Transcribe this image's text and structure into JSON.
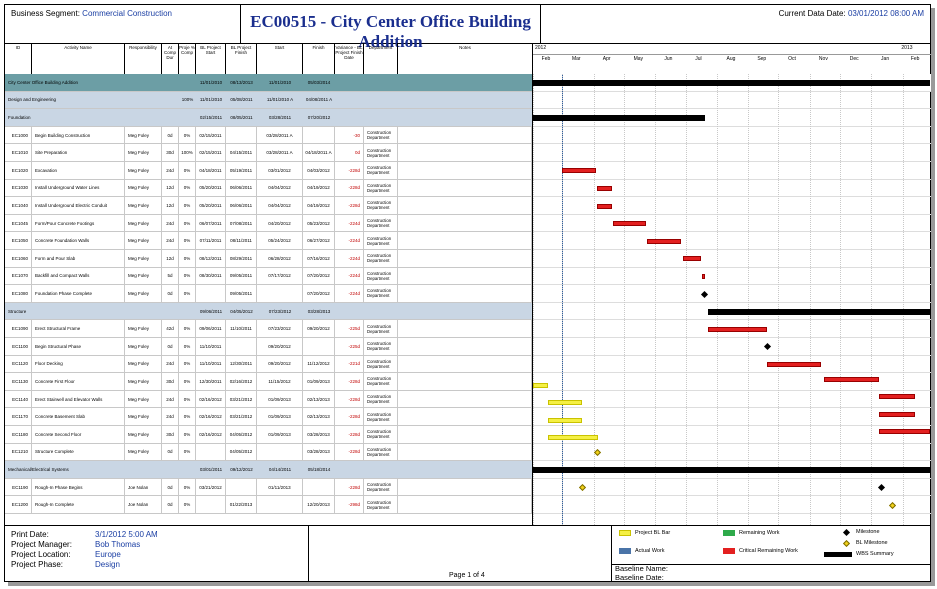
{
  "header": {
    "segment_label": "Business Segment:",
    "segment_value": "Commercial Construction",
    "title": "EC00515 - City Center Office Building Addition",
    "data_date_label": "Current Data Date:",
    "data_date_value": "03/01/2012 08:00 AM"
  },
  "columns": [
    "ID",
    "Activity Name",
    "Responsibility",
    "At Comp Dur",
    "Proje % Comp",
    "BL Project Start",
    "BL Project Finish",
    "Start",
    "Finish",
    "Variance - BL Project Finish Date",
    "Department",
    "Notes"
  ],
  "timeline": {
    "years": [
      {
        "label": "2012"
      },
      {
        "label": "2013"
      }
    ],
    "months": [
      "Feb",
      "Mar",
      "Apr",
      "May",
      "Jun",
      "Jul",
      "Aug",
      "Sep",
      "Oct",
      "Nov",
      "Dec",
      "Jan",
      "Feb"
    ]
  },
  "rows": [
    {
      "type": "sum1",
      "name": "City Center Office Building Addition",
      "bls": "11/01/2010",
      "blf": "08/13/2013",
      "start": "11/01/2010",
      "finish": "05/03/2014"
    },
    {
      "type": "sum2",
      "name": "Design and Engineering",
      "pct": "100%",
      "bls": "11/01/2010",
      "blf": "05/08/2011",
      "start": "11/01/2010 A",
      "finish": "04/08/2011 A"
    },
    {
      "type": "sum2",
      "name": "Foundation",
      "bls": "02/15/2011",
      "blf": "08/05/2011",
      "start": "03/28/2011",
      "finish": "07/20/2012"
    },
    {
      "type": "task",
      "id": "EC1000",
      "name": "Begin Building Construction",
      "resp": "Meg Foley",
      "dur": "0d",
      "pct": "0%",
      "bls": "02/15/2011",
      "blf": "",
      "start": "03/28/2011 A",
      "finish": "",
      "var": "-30",
      "dept": "Construction Department"
    },
    {
      "type": "task",
      "id": "EC1010",
      "name": "Site Preparation",
      "resp": "Meg Foley",
      "dur": "30d",
      "pct": "100%",
      "bls": "02/15/2011",
      "blf": "04/15/2011",
      "start": "03/28/2011 A",
      "finish": "04/18/2011 A",
      "var": "0d",
      "dept": "Construction Department"
    },
    {
      "type": "task",
      "id": "EC1020",
      "name": "Excavation",
      "resp": "Meg Foley",
      "dur": "24d",
      "pct": "0%",
      "bls": "04/18/2011",
      "blf": "05/19/2011",
      "start": "03/01/2012",
      "finish": "04/03/2012",
      "var": "-228d",
      "dept": "Construction Department"
    },
    {
      "type": "task",
      "id": "EC1030",
      "name": "Install Underground Water Lines",
      "resp": "Meg Foley",
      "dur": "12d",
      "pct": "0%",
      "bls": "05/20/2011",
      "blf": "06/06/2011",
      "start": "04/04/2012",
      "finish": "04/19/2012",
      "var": "-228d",
      "dept": "Construction Department"
    },
    {
      "type": "task",
      "id": "EC1040",
      "name": "Install Underground Electric Conduit",
      "resp": "Meg Foley",
      "dur": "12d",
      "pct": "0%",
      "bls": "05/20/2011",
      "blf": "06/06/2011",
      "start": "04/04/2012",
      "finish": "04/19/2012",
      "var": "-228d",
      "dept": "Construction Department"
    },
    {
      "type": "task",
      "id": "EC1045",
      "name": "Form/Pour Concrete Footings",
      "resp": "Meg Foley",
      "dur": "24d",
      "pct": "0%",
      "bls": "06/07/2011",
      "blf": "07/08/2011",
      "start": "04/20/2012",
      "finish": "05/23/2012",
      "var": "-224d",
      "dept": "Construction Department"
    },
    {
      "type": "task",
      "id": "EC1050",
      "name": "Concrete Foundation Walls",
      "resp": "Meg Foley",
      "dur": "24d",
      "pct": "0%",
      "bls": "07/11/2011",
      "blf": "08/11/2011",
      "start": "05/24/2012",
      "finish": "06/27/2012",
      "var": "-224d",
      "dept": "Construction Department"
    },
    {
      "type": "task",
      "id": "EC1060",
      "name": "Form and Pour Slab",
      "resp": "Meg Foley",
      "dur": "12d",
      "pct": "0%",
      "bls": "08/12/2011",
      "blf": "08/29/2011",
      "start": "06/28/2012",
      "finish": "07/16/2012",
      "var": "-224d",
      "dept": "Construction Department"
    },
    {
      "type": "task",
      "id": "EC1070",
      "name": "Backfill and Compact Walls",
      "resp": "Meg Foley",
      "dur": "5d",
      "pct": "0%",
      "bls": "08/30/2011",
      "blf": "09/05/2011",
      "start": "07/17/2012",
      "finish": "07/20/2012",
      "var": "-224d",
      "dept": "Construction Department"
    },
    {
      "type": "task",
      "id": "EC1080",
      "name": "Foundation Phase Complete",
      "resp": "Meg Foley",
      "dur": "0d",
      "pct": "0%",
      "bls": "",
      "blf": "09/05/2011",
      "start": "",
      "finish": "07/20/2012",
      "var": "-224d",
      "dept": "Construction Department"
    },
    {
      "type": "sum2",
      "name": "Structure",
      "bls": "09/06/2011",
      "blf": "04/05/2012",
      "start": "07/23/2012",
      "finish": "03/28/2013"
    },
    {
      "type": "task",
      "id": "EC1090",
      "name": "Erect Structural Frame",
      "resp": "Meg Foley",
      "dur": "42d",
      "pct": "0%",
      "bls": "09/06/2011",
      "blf": "11/10/2011",
      "start": "07/23/2012",
      "finish": "09/20/2012",
      "var": "-225d",
      "dept": "Construction Department"
    },
    {
      "type": "task",
      "id": "EC1100",
      "name": "Begin Structural Phase",
      "resp": "Meg Foley",
      "dur": "0d",
      "pct": "0%",
      "bls": "11/10/2011",
      "blf": "",
      "start": "09/20/2012",
      "finish": "",
      "var": "-225d",
      "dept": "Construction Department"
    },
    {
      "type": "task",
      "id": "EC1120",
      "name": "Floor Decking",
      "resp": "Meg Foley",
      "dur": "24d",
      "pct": "0%",
      "bls": "11/10/2011",
      "blf": "12/30/2011",
      "start": "09/20/2012",
      "finish": "11/12/2012",
      "var": "-221d",
      "dept": "Construction Department"
    },
    {
      "type": "task",
      "id": "EC1130",
      "name": "Concrete First Floor",
      "resp": "Meg Foley",
      "dur": "30d",
      "pct": "0%",
      "bls": "12/30/2011",
      "blf": "02/16/2012",
      "start": "11/15/2012",
      "finish": "01/09/2013",
      "var": "-228d",
      "dept": "Construction Department"
    },
    {
      "type": "task",
      "id": "EC1140",
      "name": "Erect Stairwell and Elevator Walls",
      "resp": "Meg Foley",
      "dur": "24d",
      "pct": "0%",
      "bls": "02/16/2012",
      "blf": "03/21/2012",
      "start": "01/09/2013",
      "finish": "02/13/2013",
      "var": "-228d",
      "dept": "Construction Department"
    },
    {
      "type": "task",
      "id": "EC1170",
      "name": "Concrete Basement Slab",
      "resp": "Meg Foley",
      "dur": "24d",
      "pct": "0%",
      "bls": "02/16/2012",
      "blf": "03/21/2012",
      "start": "01/09/2013",
      "finish": "02/13/2013",
      "var": "-228d",
      "dept": "Construction Department"
    },
    {
      "type": "task",
      "id": "EC1180",
      "name": "Concrete Second Floor",
      "resp": "Meg Foley",
      "dur": "30d",
      "pct": "0%",
      "bls": "02/16/2012",
      "blf": "04/05/2012",
      "start": "01/09/2013",
      "finish": "03/28/2013",
      "var": "-228d",
      "dept": "Construction Department"
    },
    {
      "type": "task",
      "id": "EC1210",
      "name": "Structure Complete",
      "resp": "Meg Foley",
      "dur": "0d",
      "pct": "0%",
      "bls": "",
      "blf": "04/05/2012",
      "start": "",
      "finish": "03/28/2013",
      "var": "-228d",
      "dept": "Construction Department"
    },
    {
      "type": "sum2",
      "name": "Mechanical/Electrical Systems",
      "bls": "03/01/2011",
      "blf": "09/12/2012",
      "start": "04/14/2011",
      "finish": "05/18/2014"
    },
    {
      "type": "task",
      "id": "EC1190",
      "name": "Rough-In Phase Begins",
      "resp": "Joe Nolan",
      "dur": "0d",
      "pct": "0%",
      "bls": "03/21/2012",
      "blf": "",
      "start": "01/11/2013",
      "finish": "",
      "var": "-228d",
      "dept": "Construction Department"
    },
    {
      "type": "task",
      "id": "EC1200",
      "name": "Rough-In Complete",
      "resp": "Joe Nolan",
      "dur": "0d",
      "pct": "0%",
      "bls": "",
      "blf": "01/22/2013",
      "start": "",
      "finish": "12/20/2013",
      "var": "-298d",
      "dept": "Construction Department"
    }
  ],
  "footer": {
    "print_date_label": "Print Date:",
    "print_date_value": "3/1/2012 5:00 AM",
    "pm_label": "Project Manager:",
    "pm_value": "Bob Thomas",
    "loc_label": "Project Location:",
    "loc_value": "Europe",
    "phase_label": "Project Phase:",
    "phase_value": "Design",
    "page": "Page 1 of 4",
    "baseline_name_label": "Baseline Name:",
    "baseline_date_label": "Baseline Date:"
  },
  "legend": {
    "items": [
      "Project BL Bar",
      "Actual Work",
      "Remaining Work",
      "Critical Remaining Work",
      "Milestone",
      "BL Milestone",
      "WBS Summary"
    ],
    "colors": {
      "bl_bar": "#f5f044",
      "actual": "#4a74a8",
      "remaining": "#2eaa4a",
      "critical": "#e32020",
      "milestone": "#000000",
      "bl_milestone": "#f1d11a",
      "wbs": "#000000"
    }
  },
  "chart_data": {
    "type": "gantt",
    "x_axis_start": "2012-02-01",
    "x_axis_end": "2013-02-28",
    "data_date": "2012-03-01",
    "bars": [
      {
        "row": 0,
        "kind": "blk",
        "start": "2012-02-01",
        "end": "2013-02-28"
      },
      {
        "row": 2,
        "kind": "blk",
        "start": "2012-02-01",
        "end": "2012-07-20"
      },
      {
        "row": 5,
        "kind": "red",
        "start": "2012-03-01",
        "end": "2012-04-03"
      },
      {
        "row": 6,
        "kind": "red",
        "start": "2012-04-04",
        "end": "2012-04-19"
      },
      {
        "row": 7,
        "kind": "red",
        "start": "2012-04-04",
        "end": "2012-04-19"
      },
      {
        "row": 8,
        "kind": "red",
        "start": "2012-04-20",
        "end": "2012-05-23"
      },
      {
        "row": 9,
        "kind": "red",
        "start": "2012-05-24",
        "end": "2012-06-27"
      },
      {
        "row": 10,
        "kind": "red",
        "start": "2012-06-28",
        "end": "2012-07-16"
      },
      {
        "row": 11,
        "kind": "red",
        "start": "2012-07-17",
        "end": "2012-07-20"
      },
      {
        "row": 13,
        "kind": "blk",
        "start": "2012-07-23",
        "end": "2013-02-28"
      },
      {
        "row": 14,
        "kind": "red",
        "start": "2012-07-23",
        "end": "2012-09-20"
      },
      {
        "row": 16,
        "kind": "red",
        "start": "2012-09-20",
        "end": "2012-11-12"
      },
      {
        "row": 17,
        "kind": "red",
        "start": "2012-11-15",
        "end": "2013-01-09"
      },
      {
        "row": 17,
        "kind": "yel",
        "start": "2012-02-01",
        "end": "2012-02-16"
      },
      {
        "row": 18,
        "kind": "red",
        "start": "2013-01-09",
        "end": "2013-02-13"
      },
      {
        "row": 18,
        "kind": "yel",
        "start": "2012-02-16",
        "end": "2012-03-21"
      },
      {
        "row": 19,
        "kind": "red",
        "start": "2013-01-09",
        "end": "2013-02-13"
      },
      {
        "row": 19,
        "kind": "yel",
        "start": "2012-02-16",
        "end": "2012-03-21"
      },
      {
        "row": 20,
        "kind": "red",
        "start": "2013-01-09",
        "end": "2013-02-28"
      },
      {
        "row": 20,
        "kind": "yel",
        "start": "2012-02-16",
        "end": "2012-04-05"
      },
      {
        "row": 22,
        "kind": "blk",
        "start": "2012-02-01",
        "end": "2013-02-28"
      }
    ],
    "milestones": [
      {
        "row": 12,
        "kind": "blk",
        "date": "2012-07-20"
      },
      {
        "row": 15,
        "kind": "blk",
        "date": "2012-09-20"
      },
      {
        "row": 21,
        "kind": "gold",
        "date": "2012-04-05"
      },
      {
        "row": 23,
        "kind": "gold",
        "date": "2012-03-21"
      },
      {
        "row": 23,
        "kind": "blk",
        "date": "2013-01-11"
      },
      {
        "row": 24,
        "kind": "gold",
        "date": "2013-01-22"
      }
    ]
  }
}
